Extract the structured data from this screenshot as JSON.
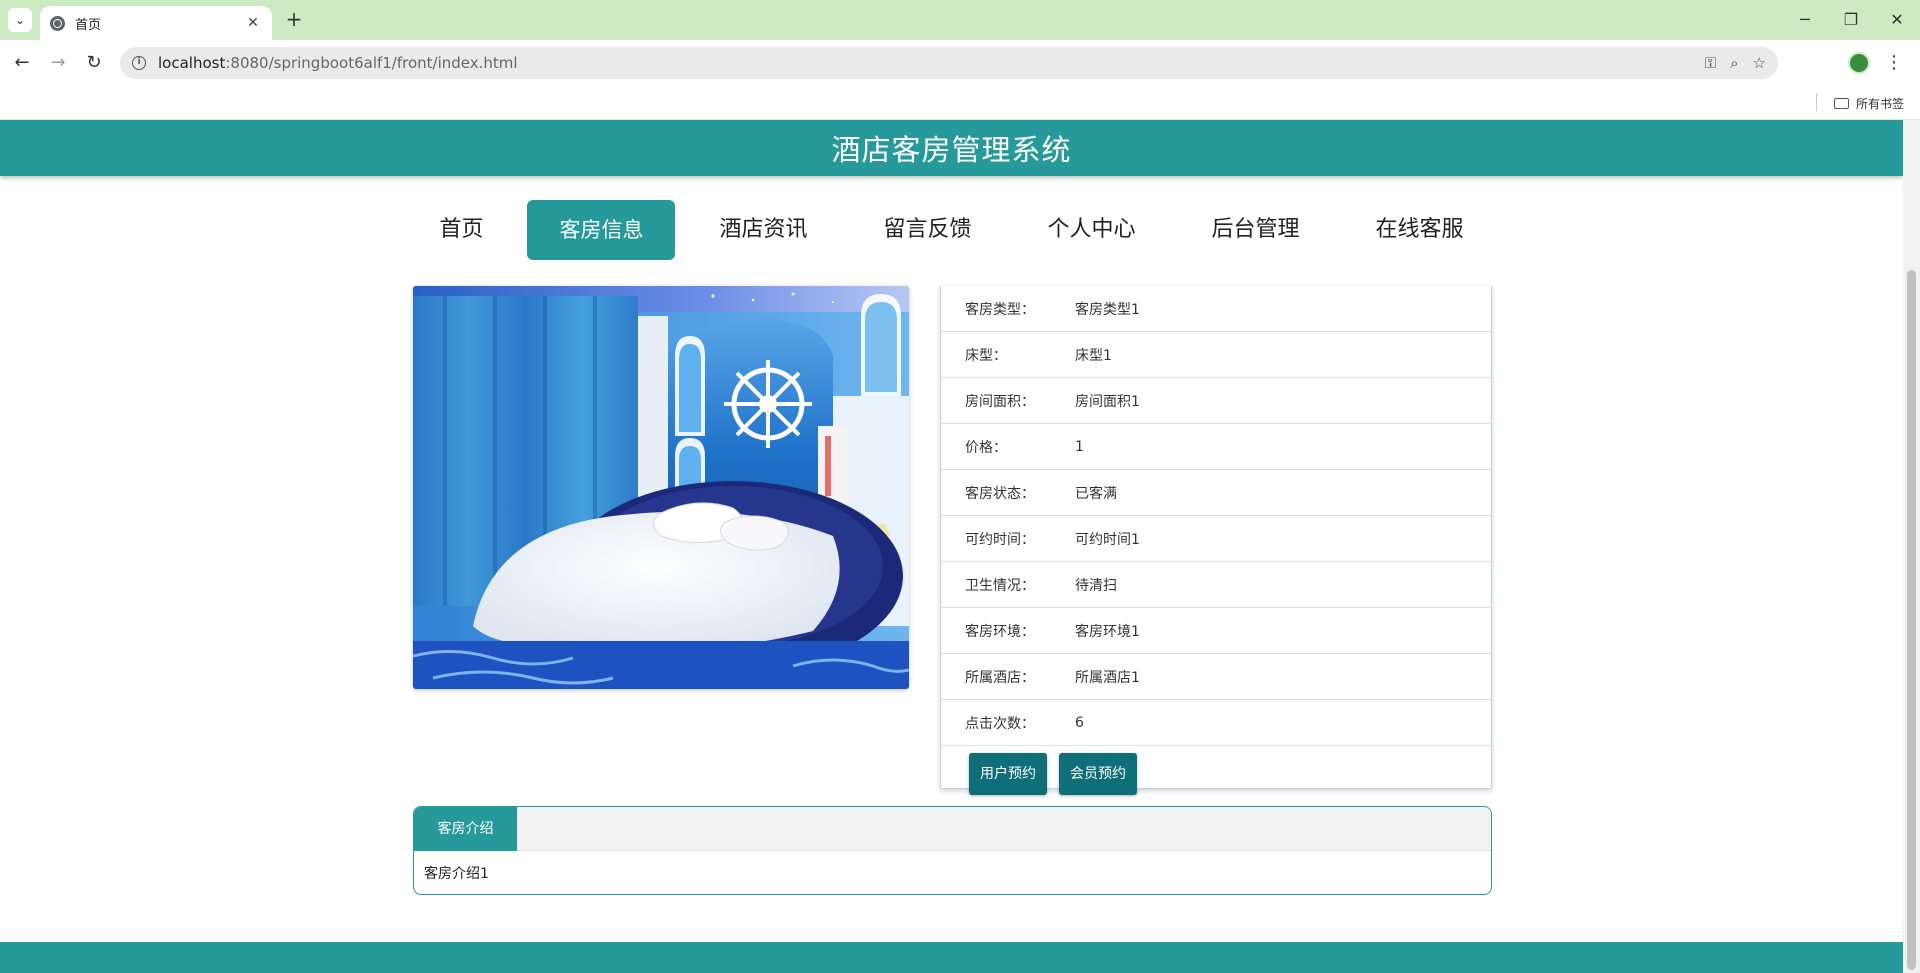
{
  "browser": {
    "tab_title": "首页",
    "tab_close": "✕",
    "new_tab": "+",
    "url_host": "localhost",
    "url_rest": ":8080/springboot6alf1/front/index.html",
    "bookmarks_all": "所有书签",
    "window_controls": {
      "minimize": "─",
      "restore": "❐",
      "close": "✕"
    },
    "icons": [
      "password-key-icon",
      "zoom-icon",
      "bookmark-star-icon"
    ]
  },
  "site": {
    "title": "酒店客房管理系统",
    "accent_color": "#269a9a",
    "nav": [
      {
        "label": "首页",
        "active": false
      },
      {
        "label": "客房信息",
        "active": true
      },
      {
        "label": "酒店资讯",
        "active": false
      },
      {
        "label": "留言反馈",
        "active": false
      },
      {
        "label": "个人中心",
        "active": false
      },
      {
        "label": "后台管理",
        "active": false
      },
      {
        "label": "在线客服",
        "active": false
      }
    ]
  },
  "room": {
    "details": [
      {
        "label": "客房类型：",
        "value": "客房类型1"
      },
      {
        "label": "床型：",
        "value": "床型1"
      },
      {
        "label": "房间面积：",
        "value": "房间面积1"
      },
      {
        "label": "价格：",
        "value": "1"
      },
      {
        "label": "客房状态：",
        "value": "已客满"
      },
      {
        "label": "可约时间：",
        "value": "可约时间1"
      },
      {
        "label": "卫生情况：",
        "value": "待清扫"
      },
      {
        "label": "客房环境：",
        "value": "客房环境1"
      },
      {
        "label": "所属酒店：",
        "value": "所属酒店1"
      },
      {
        "label": "点击次数：",
        "value": "6"
      }
    ],
    "buttons": {
      "user_booking": "用户预约",
      "member_booking": "会员预约"
    },
    "intro_tab": "客房介绍",
    "intro_text": "客房介绍1"
  }
}
